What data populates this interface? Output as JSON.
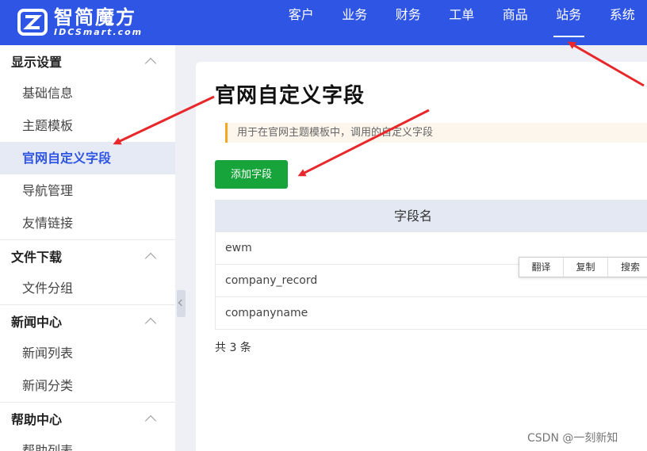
{
  "header": {
    "logo_cn": "智简魔方",
    "logo_en": "IDCSmart.com",
    "nav": [
      {
        "label": "客户",
        "active": false
      },
      {
        "label": "业务",
        "active": false
      },
      {
        "label": "财务",
        "active": false
      },
      {
        "label": "工单",
        "active": false
      },
      {
        "label": "商品",
        "active": false
      },
      {
        "label": "站务",
        "active": true
      },
      {
        "label": "系统",
        "active": false
      }
    ]
  },
  "sidebar": {
    "groups": [
      {
        "title": "显示设置",
        "items": [
          "基础信息",
          "主题模板",
          "官网自定义字段",
          "导航管理",
          "友情链接"
        ]
      },
      {
        "title": "文件下载",
        "items": [
          "文件分组"
        ]
      },
      {
        "title": "新闻中心",
        "items": [
          "新闻列表",
          "新闻分类"
        ]
      },
      {
        "title": "帮助中心",
        "items": [
          "帮助列表"
        ]
      }
    ]
  },
  "main": {
    "title": "官网自定义字段",
    "notice": "用于在官网主题模板中，调用的自定义字段",
    "add_button": "添加字段",
    "table": {
      "header": "字段名",
      "rows": [
        "ewm",
        "company_record",
        "companyname"
      ]
    },
    "total": "共 3 条"
  },
  "context_menu": [
    "翻译",
    "复制",
    "搜索"
  ],
  "watermark": "CSDN @一刻新知",
  "colors": {
    "header_bg": "#2f55e4",
    "accent": "#2f55e4",
    "button": "#17a43a",
    "arrow": "#e8272b"
  }
}
